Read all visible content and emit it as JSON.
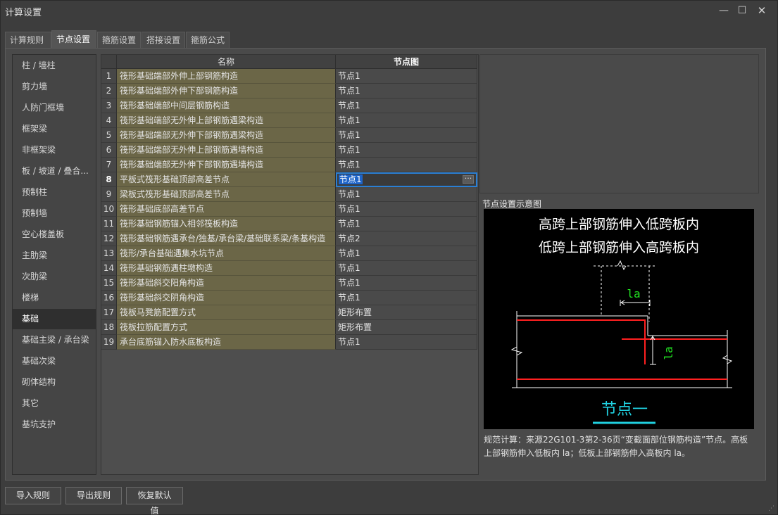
{
  "window": {
    "title": "计算设置",
    "min_glyph": "—",
    "max_glyph": "☐",
    "close_glyph": "✕"
  },
  "tabs": [
    "计算规则",
    "节点设置",
    "箍筋设置",
    "搭接设置",
    "箍筋公式"
  ],
  "active_tab": "节点设置",
  "sidebar": {
    "items": [
      "柱 / 墙柱",
      "剪力墙",
      "人防门框墙",
      "框架梁",
      "非框架梁",
      "板 / 坡道 / 叠合...",
      "预制柱",
      "预制墙",
      "空心楼盖板",
      "主肋梁",
      "次肋梁",
      "楼梯",
      "基础",
      "基础主梁 / 承台梁",
      "基础次梁",
      "砌体结构",
      "其它",
      "基坑支护"
    ],
    "active": "基础"
  },
  "grid": {
    "headers": {
      "name": "名称",
      "node": "节点图"
    },
    "rows": [
      {
        "num": "1",
        "name": "筏形基础端部外伸上部钢筋构造",
        "node": "节点1"
      },
      {
        "num": "2",
        "name": "筏形基础端部外伸下部钢筋构造",
        "node": "节点1"
      },
      {
        "num": "3",
        "name": "筏形基础端部中间层钢筋构造",
        "node": "节点1"
      },
      {
        "num": "4",
        "name": "筏形基础端部无外伸上部钢筋遇梁构造",
        "node": "节点1"
      },
      {
        "num": "5",
        "name": "筏形基础端部无外伸下部钢筋遇梁构造",
        "node": "节点1"
      },
      {
        "num": "6",
        "name": "筏形基础端部无外伸上部钢筋遇墙构造",
        "node": "节点1"
      },
      {
        "num": "7",
        "name": "筏形基础端部无外伸下部钢筋遇墙构造",
        "node": "节点1"
      },
      {
        "num": "8",
        "name": "平板式筏形基础顶部高差节点",
        "node": "节点1"
      },
      {
        "num": "9",
        "name": "梁板式筏形基础顶部高差节点",
        "node": "节点1"
      },
      {
        "num": "10",
        "name": "筏形基础底部高差节点",
        "node": "节点1"
      },
      {
        "num": "11",
        "name": "筏形基础钢筋锚入相邻筏板构造",
        "node": "节点1"
      },
      {
        "num": "12",
        "name": "筏形基础钢筋遇承台/独基/承台梁/基础联系梁/条基构造",
        "node": "节点2"
      },
      {
        "num": "13",
        "name": "筏形/承台基础遇集水坑节点",
        "node": "节点1"
      },
      {
        "num": "14",
        "name": "筏形基础钢筋遇柱墩构造",
        "node": "节点1"
      },
      {
        "num": "15",
        "name": "筏形基础斜交阳角构造",
        "node": "节点1"
      },
      {
        "num": "16",
        "name": "筏形基础斜交阴角构造",
        "node": "节点1"
      },
      {
        "num": "17",
        "name": "筏板马凳筋配置方式",
        "node": "矩形布置"
      },
      {
        "num": "18",
        "name": "筏板拉筋配置方式",
        "node": "矩形布置"
      },
      {
        "num": "19",
        "name": "承台底筋锚入防水底板构造",
        "node": "节点1"
      }
    ],
    "selected_row": "8",
    "ellipsis": "···"
  },
  "preview": {
    "title": "节点设置示意图",
    "line1": "高跨上部钢筋伸入低跨板内",
    "line2": "低跨上部钢筋伸入高跨板内",
    "dim_label_h": "la",
    "dim_label_v": "la",
    "caption": "节点一",
    "colors": {
      "rebar": "#ff2020",
      "dim": "#22e022",
      "caption": "#20d0e0",
      "outline": "#ffffff"
    }
  },
  "description": "规范计算：来源22G101-3第2-36页“变截面部位钢筋构造”节点。高板上部钢筋伸入低板内 la；低板上部钢筋伸入高板内 la。",
  "buttons": {
    "import": "导入规则",
    "export": "导出规则",
    "restore": "恢复默认值"
  }
}
